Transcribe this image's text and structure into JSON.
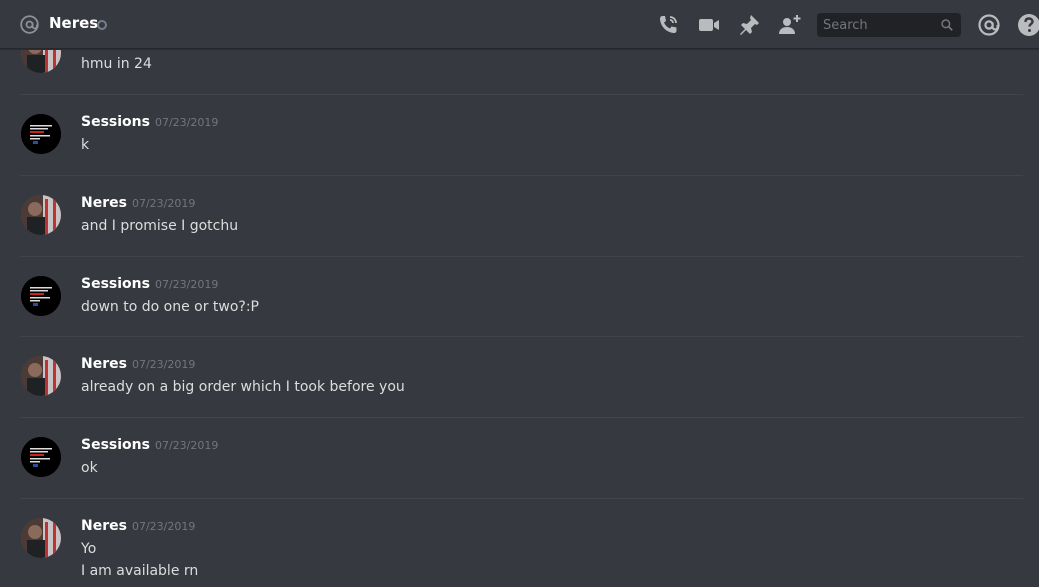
{
  "header": {
    "channel_name": "Neres",
    "search_placeholder": "Search",
    "icons": {
      "channel": "at-icon",
      "status": "status-ring-icon",
      "call": "phone-call-icon",
      "video": "video-camera-icon",
      "pin": "pin-icon",
      "add_friend": "add-friend-icon",
      "search": "search-icon",
      "mentions": "mention-icon",
      "help": "help-icon"
    }
  },
  "messages": [
    {
      "author": "",
      "timestamp": "",
      "lines": [
        "hmu in 24"
      ],
      "avatar": "neres"
    },
    {
      "author": "Sessions",
      "timestamp": "07/23/2019",
      "lines": [
        "k"
      ],
      "avatar": "sessions"
    },
    {
      "author": "Neres",
      "timestamp": "07/23/2019",
      "lines": [
        "and I promise I gotchu"
      ],
      "avatar": "neres"
    },
    {
      "author": "Sessions",
      "timestamp": "07/23/2019",
      "lines": [
        "down to do one or two?:P"
      ],
      "avatar": "sessions"
    },
    {
      "author": "Neres",
      "timestamp": "07/23/2019",
      "lines": [
        "already on a big order which I took before you"
      ],
      "avatar": "neres"
    },
    {
      "author": "Sessions",
      "timestamp": "07/23/2019",
      "lines": [
        "ok"
      ],
      "avatar": "sessions"
    },
    {
      "author": "Neres",
      "timestamp": "07/23/2019",
      "lines": [
        "Yo",
        "I am available rn"
      ],
      "avatar": "neres"
    }
  ],
  "colors": {
    "background": "#36393f",
    "search_bg": "#202225",
    "divider": "#40444b",
    "timestamp": "#72767d",
    "text": "#dcddde",
    "icon": "#b9bbbe"
  }
}
